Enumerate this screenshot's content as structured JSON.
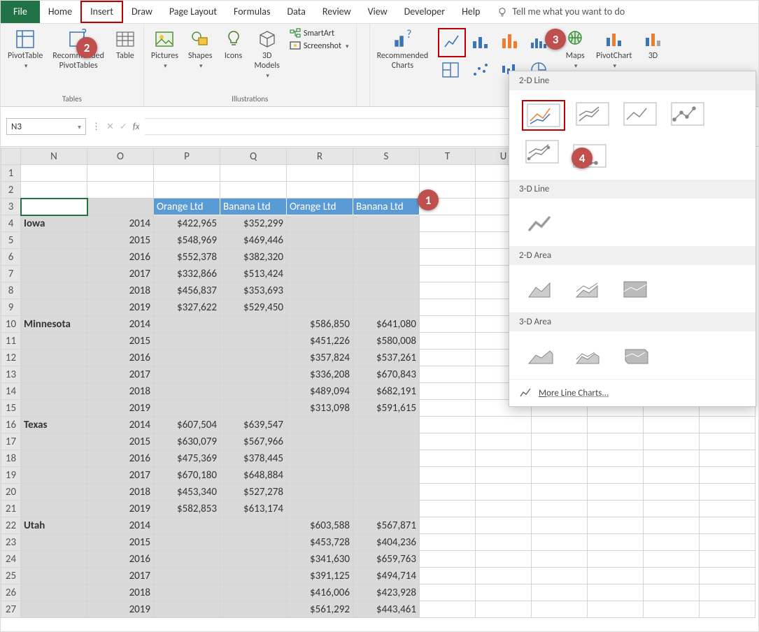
{
  "tabs": {
    "file": "File",
    "home": "Home",
    "insert": "Insert",
    "draw": "Draw",
    "pagelayout": "Page Layout",
    "formulas": "Formulas",
    "data": "Data",
    "review": "Review",
    "view": "View",
    "developer": "Developer",
    "help": "Help",
    "tell": "Tell me what you want to do"
  },
  "ribbon": {
    "pivottable": "PivotTable",
    "recpivot": "Recommended\nPivotTables",
    "table": "Table",
    "tables_group": "Tables",
    "pictures": "Pictures",
    "shapes": "Shapes",
    "icons": "Icons",
    "models": "3D\nModels",
    "smartart": "SmartArt",
    "screenshot": "Screenshot",
    "illus_group": "Illustrations",
    "reccharts": "Recommended\nCharts",
    "maps": "Maps",
    "pivotchart": "PivotChart",
    "threeD": "3D"
  },
  "namebox": "N3",
  "columns": [
    "N",
    "O",
    "P",
    "Q",
    "R",
    "S",
    "T",
    "U"
  ],
  "headers": {
    "P": "Orange Ltd",
    "Q": "Banana Ltd",
    "R": "Orange Ltd",
    "S": "Banana Ltd"
  },
  "rows": [
    {
      "r": 1
    },
    {
      "r": 2
    },
    {
      "r": 3,
      "hdr": true
    },
    {
      "r": 4,
      "N": "Iowa",
      "O": "2014",
      "P": "$422,965",
      "Q": "$352,299"
    },
    {
      "r": 5,
      "O": "2015",
      "P": "$548,969",
      "Q": "$469,446"
    },
    {
      "r": 6,
      "O": "2016",
      "P": "$552,378",
      "Q": "$382,320"
    },
    {
      "r": 7,
      "O": "2017",
      "P": "$332,866",
      "Q": "$513,424"
    },
    {
      "r": 8,
      "O": "2018",
      "P": "$456,837",
      "Q": "$353,693"
    },
    {
      "r": 9,
      "O": "2019",
      "P": "$327,622",
      "Q": "$529,450"
    },
    {
      "r": 10,
      "N": "Minnesota",
      "O": "2014",
      "R": "$586,850",
      "S": "$641,080"
    },
    {
      "r": 11,
      "O": "2015",
      "R": "$451,226",
      "S": "$580,008"
    },
    {
      "r": 12,
      "O": "2016",
      "R": "$357,824",
      "S": "$537,261"
    },
    {
      "r": 13,
      "O": "2017",
      "R": "$336,208",
      "S": "$670,843"
    },
    {
      "r": 14,
      "O": "2018",
      "R": "$489,094",
      "S": "$682,191"
    },
    {
      "r": 15,
      "O": "2019",
      "R": "$313,098",
      "S": "$591,615"
    },
    {
      "r": 16,
      "N": "Texas",
      "O": "2014",
      "P": "$607,504",
      "Q": "$639,547"
    },
    {
      "r": 17,
      "O": "2015",
      "P": "$630,079",
      "Q": "$567,966"
    },
    {
      "r": 18,
      "O": "2016",
      "P": "$475,369",
      "Q": "$378,445"
    },
    {
      "r": 19,
      "O": "2017",
      "P": "$670,180",
      "Q": "$648,884"
    },
    {
      "r": 20,
      "O": "2018",
      "P": "$453,340",
      "Q": "$527,278"
    },
    {
      "r": 21,
      "O": "2019",
      "P": "$582,853",
      "Q": "$613,174"
    },
    {
      "r": 22,
      "N": "Utah",
      "O": "2014",
      "R": "$603,588",
      "S": "$567,871"
    },
    {
      "r": 23,
      "O": "2015",
      "R": "$453,728",
      "S": "$404,236"
    },
    {
      "r": 24,
      "O": "2016",
      "R": "$341,630",
      "S": "$659,763"
    },
    {
      "r": 25,
      "O": "2017",
      "R": "$391,125",
      "S": "$494,714"
    },
    {
      "r": 26,
      "O": "2018",
      "R": "$416,006",
      "S": "$423,928"
    },
    {
      "r": 27,
      "O": "2019",
      "R": "$561,292",
      "S": "$443,461"
    }
  ],
  "panel": {
    "s1": "2-D Line",
    "s2": "3-D Line",
    "s3": "2-D Area",
    "s4": "3-D Area",
    "more": "More Line Charts...",
    "moreKey": "M"
  },
  "callouts": {
    "c1": "1",
    "c2": "2",
    "c3": "3",
    "c4": "4"
  }
}
